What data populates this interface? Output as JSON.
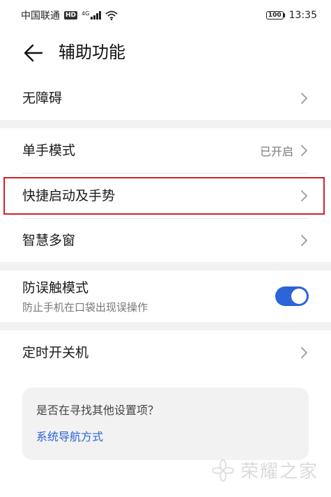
{
  "status_bar": {
    "carrier": "中国联通",
    "hd_badge": "HD",
    "network": "4G",
    "battery": "100",
    "time": "13:35"
  },
  "header": {
    "back_icon": "arrow-left-icon",
    "title": "辅助功能"
  },
  "rows": {
    "accessibility": {
      "label": "无障碍"
    },
    "one_hand_mode": {
      "label": "单手模式",
      "value": "已开启"
    },
    "shortcuts_gestures": {
      "label": "快捷启动及手势"
    },
    "smart_multiwindow": {
      "label": "智慧多窗"
    },
    "accidental_touch": {
      "label": "防误触模式",
      "sublabel": "防止手机在口袋出现误操作",
      "toggle_on": true
    },
    "scheduled_power": {
      "label": "定时开关机"
    }
  },
  "suggestion": {
    "question": "是否在寻找其他设置项？",
    "link": "系统导航方式"
  },
  "watermark": {
    "text": "荣耀之家"
  },
  "colors": {
    "accent": "#2a64d8",
    "highlight": "#d0202a",
    "section_bg": "#f2f2f2"
  }
}
